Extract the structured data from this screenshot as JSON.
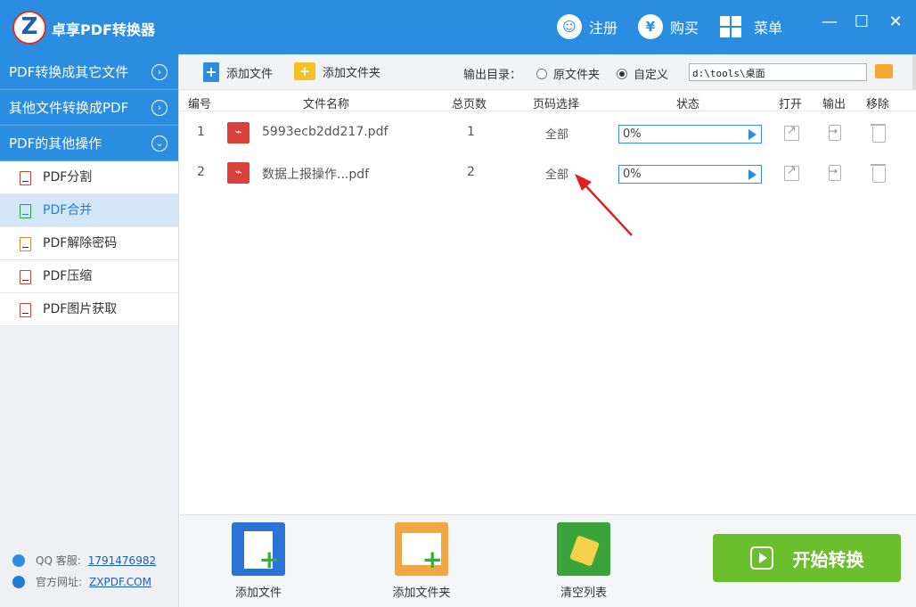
{
  "app": {
    "title": "卓享PDF转换器",
    "logo_letter": "Z"
  },
  "titlebar": {
    "register": "注册",
    "buy": "购买",
    "menu": "菜单"
  },
  "sidebar": {
    "sections": [
      {
        "label": "PDF转换成其它文件",
        "chevron": "›"
      },
      {
        "label": "其他文件转换成PDF",
        "chevron": "›"
      },
      {
        "label": "PDF的其他操作",
        "chevron": "⌄"
      }
    ],
    "items": [
      {
        "label": "PDF分割"
      },
      {
        "label": "PDF合并"
      },
      {
        "label": "PDF解除密码"
      },
      {
        "label": "PDF压缩"
      },
      {
        "label": "PDF图片获取"
      }
    ],
    "qq_label": "QQ 客服:",
    "qq_value": "1791476982",
    "site_label": "官方网址:",
    "site_value": "ZXPDF.COM"
  },
  "toolbar": {
    "add_file": "添加文件",
    "add_folder": "添加文件夹",
    "output_dir_label": "输出目录：",
    "radio_original": "原文件夹",
    "radio_custom": "自定义",
    "output_path": "d:\\tools\\桌面"
  },
  "table": {
    "headers": [
      "编号",
      "文件名称",
      "总页数",
      "页码选择",
      "状态",
      "打开",
      "输出",
      "移除"
    ],
    "rows": [
      {
        "num": "1",
        "name": "5993ecb2dd217.pdf",
        "pages": "1",
        "range": "全部",
        "status": "0%"
      },
      {
        "num": "2",
        "name": "数据上报操作...pdf",
        "pages": "2",
        "range": "全部",
        "status": "0%"
      }
    ]
  },
  "bottom": {
    "add_file": "添加文件",
    "add_folder": "添加文件夹",
    "clear_list": "清空列表",
    "start": "开始转换"
  },
  "colors": {
    "primary": "#2a8de0",
    "start_green": "#6bbf2c",
    "pdf_red": "#d9413a",
    "annotation_arrow": "#e02020"
  }
}
